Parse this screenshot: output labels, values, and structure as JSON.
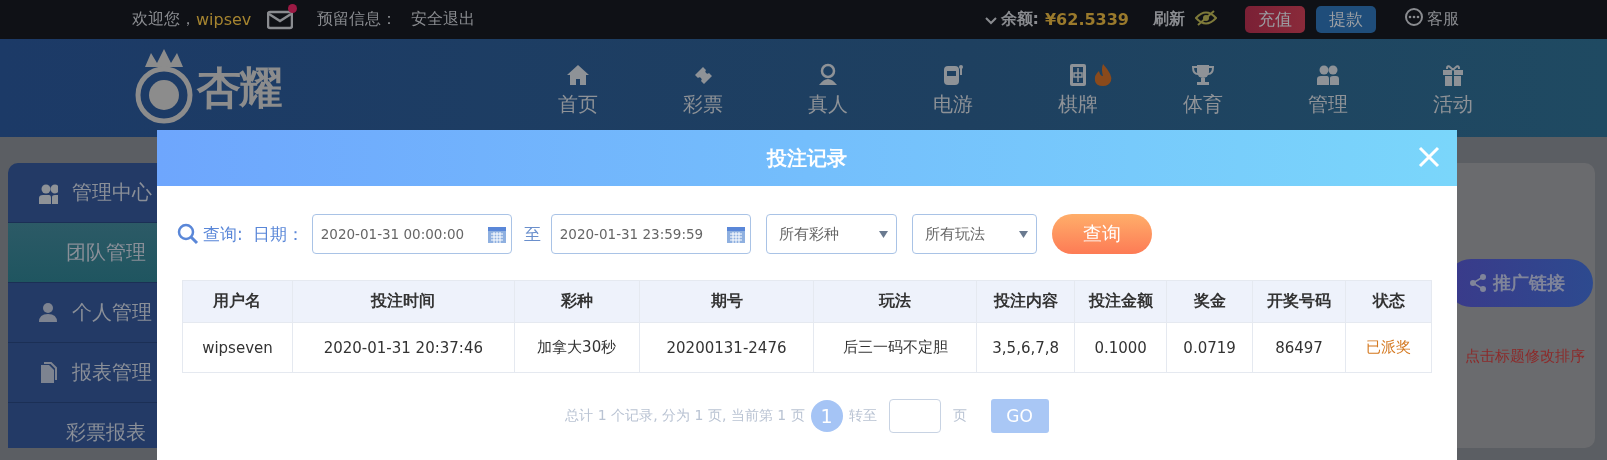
{
  "top_bar": {
    "welcome": "欢迎您，",
    "username": "wipsev",
    "mail_unread": true,
    "reserved_info": "预留信息：",
    "logout": "安全退出",
    "balance_label": "余额:",
    "balance": "¥62.5339",
    "refresh": "刷新",
    "deposit": "充值",
    "withdraw": "提款",
    "support": "客服"
  },
  "logo": {
    "text": "杏耀"
  },
  "nav": [
    {
      "label": "首页",
      "hot": false
    },
    {
      "label": "彩票",
      "hot": false
    },
    {
      "label": "真人",
      "hot": false
    },
    {
      "label": "电游",
      "hot": false
    },
    {
      "label": "棋牌",
      "hot": true
    },
    {
      "label": "体育",
      "hot": false
    },
    {
      "label": "管理",
      "hot": false
    },
    {
      "label": "活动",
      "hot": false
    }
  ],
  "sidebar": {
    "items": [
      {
        "label": "管理中心",
        "kind": "header",
        "selected": false
      },
      {
        "label": "团队管理",
        "kind": "sub",
        "selected": true
      },
      {
        "label": "个人管理",
        "kind": "header",
        "selected": false
      },
      {
        "label": "报表管理",
        "kind": "header",
        "selected": false
      },
      {
        "label": "彩票报表",
        "kind": "sub",
        "selected": false
      }
    ]
  },
  "background_card": {
    "promo_button": "推广链接",
    "hint": "点击标题修改排序"
  },
  "dialog": {
    "title": "投注记录",
    "filters": {
      "query_label": "查询:",
      "date_label": "日期：",
      "date_from": "2020-01-31 00:00:00",
      "to_label": "至",
      "date_to": "2020-01-31 23:59:59",
      "lottery_select": "所有彩种",
      "play_select": "所有玩法",
      "search_button": "查询"
    },
    "table": {
      "columns": [
        "用户名",
        "投注时间",
        "彩种",
        "期号",
        "玩法",
        "投注内容",
        "投注金额",
        "奖金",
        "开奖号码",
        "状态"
      ],
      "rows": [
        {
          "cells": [
            "wipseven",
            "2020-01-31 20:37:46",
            "加拿大30秒",
            "20200131-2476",
            "后三一码不定胆",
            "3,5,6,7,8",
            "0.1000",
            "0.0719",
            "86497",
            "已派奖"
          ]
        }
      ]
    },
    "pagination": {
      "summary": "总计 1 个记录, 分为 1 页, 当前第 1 页",
      "pages": [
        {
          "label": "1",
          "selected": true
        }
      ],
      "goto_label": "转至",
      "page_unit": "页",
      "go_button": "GO"
    }
  }
}
